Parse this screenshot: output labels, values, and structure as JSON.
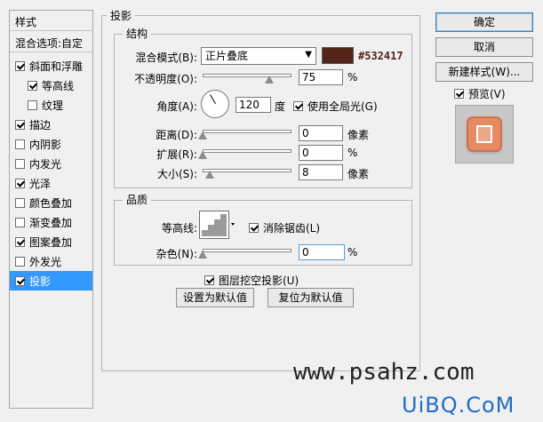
{
  "left_panel": {
    "title": "样式",
    "blend_options": "混合选项:自定",
    "items": [
      {
        "label": "斜面和浮雕",
        "checked": true,
        "indent": false,
        "selected": false
      },
      {
        "label": "等高线",
        "checked": true,
        "indent": true,
        "selected": false
      },
      {
        "label": "纹理",
        "checked": false,
        "indent": true,
        "selected": false
      },
      {
        "label": "描边",
        "checked": true,
        "indent": false,
        "selected": false
      },
      {
        "label": "内阴影",
        "checked": false,
        "indent": false,
        "selected": false
      },
      {
        "label": "内发光",
        "checked": false,
        "indent": false,
        "selected": false
      },
      {
        "label": "光泽",
        "checked": true,
        "indent": false,
        "selected": false
      },
      {
        "label": "颜色叠加",
        "checked": false,
        "indent": false,
        "selected": false
      },
      {
        "label": "渐变叠加",
        "checked": false,
        "indent": false,
        "selected": false
      },
      {
        "label": "图案叠加",
        "checked": true,
        "indent": false,
        "selected": false
      },
      {
        "label": "外发光",
        "checked": false,
        "indent": false,
        "selected": false
      },
      {
        "label": "投影",
        "checked": true,
        "indent": false,
        "selected": true
      }
    ]
  },
  "section_title": "投影",
  "structure": {
    "title": "结构",
    "blend_mode_label": "混合模式(B):",
    "blend_mode_value": "正片叠底",
    "color_hex": "#532417",
    "color_label": "#532417",
    "opacity_label": "不透明度(O):",
    "opacity_value": "75",
    "opacity_unit": "%",
    "opacity_pct": 75,
    "angle_label": "角度(A):",
    "angle_value": "120",
    "angle_unit": "度",
    "global_light_label": "使用全局光(G)",
    "global_light_checked": true,
    "distance_label": "距离(D):",
    "distance_value": "0",
    "distance_unit": "像素",
    "spread_label": "扩展(R):",
    "spread_value": "0",
    "spread_unit": "%",
    "size_label": "大小(S):",
    "size_value": "8",
    "size_unit": "像素"
  },
  "quality": {
    "title": "品质",
    "contour_label": "等高线:",
    "antialias_label": "消除锯齿(L)",
    "antialias_checked": true,
    "noise_label": "杂色(N):",
    "noise_value": "0",
    "noise_unit": "%"
  },
  "knockout_label": "图层挖空投影(U)",
  "knockout_checked": true,
  "make_default": "设置为默认值",
  "reset_default": "复位为默认值",
  "buttons": {
    "ok": "确定",
    "cancel": "取消",
    "new_style": "新建样式(W)...",
    "preview": "预览(V)",
    "preview_checked": true
  },
  "watermark": {
    "line1": "www.psahz.com",
    "line2": "UiBQ.CoM"
  },
  "colors": {
    "selection": "#3399ff",
    "preview_tile": "#e58a62"
  }
}
